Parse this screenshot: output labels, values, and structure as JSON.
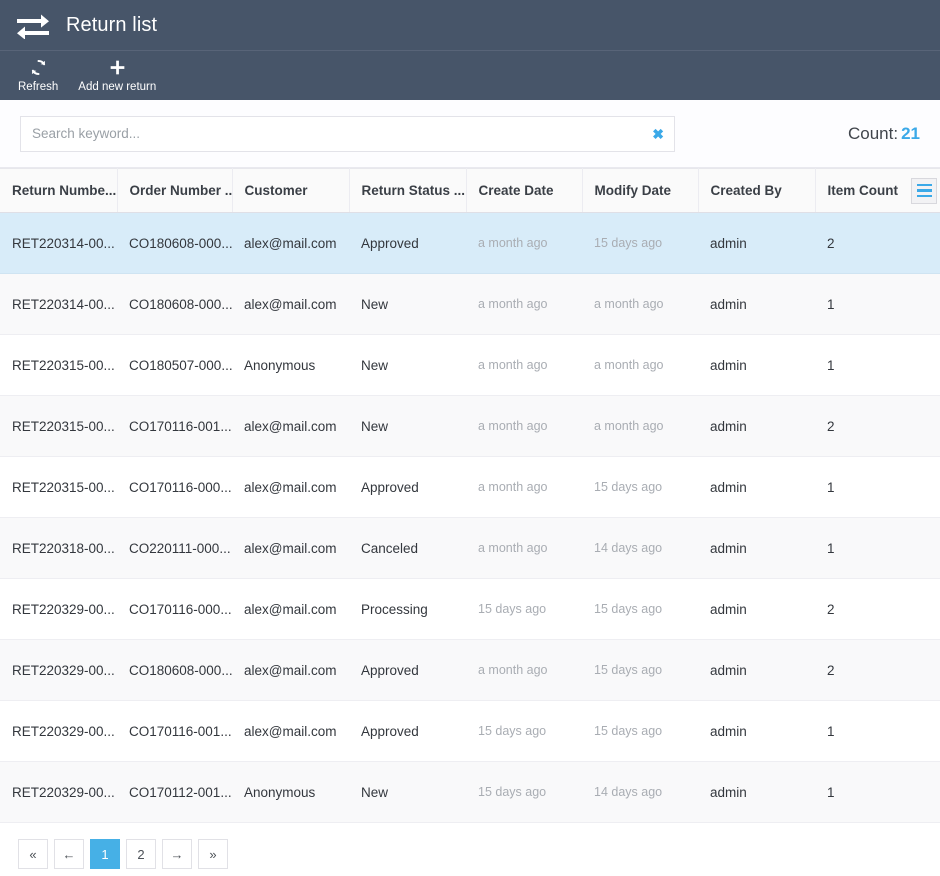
{
  "window": {
    "title": "Return list",
    "title_icon": "return-exchange-arrows-icon"
  },
  "toolbar": {
    "buttons": [
      {
        "label": "Refresh",
        "icon": "refresh-icon"
      },
      {
        "label": "Add new return",
        "icon": "plus-icon"
      }
    ]
  },
  "search": {
    "placeholder": "Search keyword...",
    "value": "",
    "clear_icon": "clear-x-icon",
    "clear_glyph": "✖",
    "count_label": "Count:",
    "count_value": "21"
  },
  "grid": {
    "column_menu_icon": "column-menu-hamburger-icon",
    "columns": [
      "Return Numbe...",
      "Order Number ...",
      "Customer",
      "Return Status ...",
      "Create Date",
      "Modify Date",
      "Created By",
      "Item Count"
    ],
    "rows": [
      {
        "return_number": "RET220314-00...",
        "order_number": "CO180608-000...",
        "customer": "alex@mail.com",
        "return_status": "Approved",
        "create_date": "a month ago",
        "modify_date": "15 days ago",
        "created_by": "admin",
        "item_count": "2",
        "selected": true
      },
      {
        "return_number": "RET220314-00...",
        "order_number": "CO180608-000...",
        "customer": "alex@mail.com",
        "return_status": "New",
        "create_date": "a month ago",
        "modify_date": "a month ago",
        "created_by": "admin",
        "item_count": "1",
        "selected": false
      },
      {
        "return_number": "RET220315-00...",
        "order_number": "CO180507-000...",
        "customer": "Anonymous",
        "return_status": "New",
        "create_date": "a month ago",
        "modify_date": "a month ago",
        "created_by": "admin",
        "item_count": "1",
        "selected": false
      },
      {
        "return_number": "RET220315-00...",
        "order_number": "CO170116-001...",
        "customer": "alex@mail.com",
        "return_status": "New",
        "create_date": "a month ago",
        "modify_date": "a month ago",
        "created_by": "admin",
        "item_count": "2",
        "selected": false
      },
      {
        "return_number": "RET220315-00...",
        "order_number": "CO170116-000...",
        "customer": "alex@mail.com",
        "return_status": "Approved",
        "create_date": "a month ago",
        "modify_date": "15 days ago",
        "created_by": "admin",
        "item_count": "1",
        "selected": false
      },
      {
        "return_number": "RET220318-00...",
        "order_number": "CO220111-000...",
        "customer": "alex@mail.com",
        "return_status": "Canceled",
        "create_date": "a month ago",
        "modify_date": "14 days ago",
        "created_by": "admin",
        "item_count": "1",
        "selected": false
      },
      {
        "return_number": "RET220329-00...",
        "order_number": "CO170116-000...",
        "customer": "alex@mail.com",
        "return_status": "Processing",
        "create_date": "15 days ago",
        "modify_date": "15 days ago",
        "created_by": "admin",
        "item_count": "2",
        "selected": false
      },
      {
        "return_number": "RET220329-00...",
        "order_number": "CO180608-000...",
        "customer": "alex@mail.com",
        "return_status": "Approved",
        "create_date": "a month ago",
        "modify_date": "15 days ago",
        "created_by": "admin",
        "item_count": "2",
        "selected": false
      },
      {
        "return_number": "RET220329-00...",
        "order_number": "CO170116-001...",
        "customer": "alex@mail.com",
        "return_status": "Approved",
        "create_date": "15 days ago",
        "modify_date": "15 days ago",
        "created_by": "admin",
        "item_count": "1",
        "selected": false
      },
      {
        "return_number": "RET220329-00...",
        "order_number": "CO170112-001...",
        "customer": "Anonymous",
        "return_status": "New",
        "create_date": "15 days ago",
        "modify_date": "14 days ago",
        "created_by": "admin",
        "item_count": "1",
        "selected": false
      }
    ]
  },
  "pagination": {
    "buttons": [
      {
        "label": "«",
        "name": "first-page-button",
        "active": false
      },
      {
        "label": "←",
        "name": "prev-page-button",
        "active": false
      },
      {
        "label": "1",
        "name": "page-1-button",
        "active": true
      },
      {
        "label": "2",
        "name": "page-2-button",
        "active": false
      },
      {
        "label": "→",
        "name": "next-page-button",
        "active": false
      },
      {
        "label": "»",
        "name": "last-page-button",
        "active": false
      }
    ]
  },
  "colors": {
    "chrome": "#475569",
    "accent": "#3ba9e8",
    "selected_row": "#d8ecf9",
    "stripe_row": "#f9f9fa"
  }
}
